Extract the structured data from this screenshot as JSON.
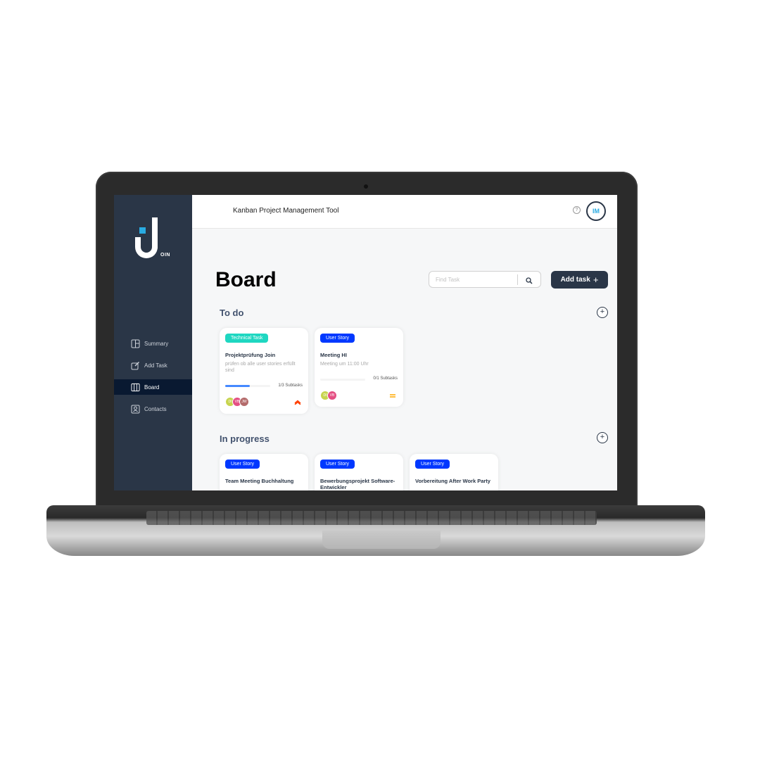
{
  "app": {
    "header_title": "Kanban Project Management Tool",
    "help_symbol": "?",
    "user_initials": "IM",
    "logo_word": "OIN"
  },
  "sidebar": {
    "items": [
      {
        "label": "Summary",
        "icon": "summary-icon",
        "active": false
      },
      {
        "label": "Add Task",
        "icon": "add-task-icon",
        "active": false
      },
      {
        "label": "Board",
        "icon": "board-icon",
        "active": true
      },
      {
        "label": "Contacts",
        "icon": "contacts-icon",
        "active": false
      }
    ]
  },
  "board": {
    "title": "Board",
    "search_placeholder": "Find Task",
    "add_task_label": "Add task",
    "add_task_symbol": "+"
  },
  "columns": {
    "todo": {
      "title": "To do",
      "cards": [
        {
          "tag": "Technical Task",
          "title": "Projektprüfung Join",
          "desc": "prüfen ob alle user stories erfüllt sind",
          "subtasks": "1/3 Subtasks",
          "progress": 0.54,
          "avatars": [
            {
              "initials": "DI",
              "color": "#c7d44f"
            },
            {
              "initials": "VB",
              "color": "#e44f83"
            },
            {
              "initials": "JW",
              "color": "#b46b6b"
            }
          ],
          "priority": "high"
        },
        {
          "tag": "User Story",
          "title": "Meeting HI",
          "desc": "Meeting um 11:00 Uhr",
          "subtasks": "0/1 Subtasks",
          "progress": 0.0,
          "avatars": [
            {
              "initials": "DI",
              "color": "#c7d44f"
            },
            {
              "initials": "VB",
              "color": "#e44f83"
            }
          ],
          "priority": "medium"
        }
      ]
    },
    "in_progress": {
      "title": "In progress",
      "cards": [
        {
          "tag": "User Story",
          "title": "Team Meeting Buchhaltung"
        },
        {
          "tag": "User Story",
          "title": "Bewerbungsprojekt Software-Entwickler"
        },
        {
          "tag": "User Story",
          "title": "Vorbereitung After Work Party"
        }
      ]
    },
    "add_symbol": "+"
  },
  "colors": {
    "sidebar": "#2a3647",
    "sidebar_active": "#091931",
    "accent": "#29abe2",
    "tag_technical": "#1fd7c1",
    "tag_story": "#0038ff",
    "priority_high": "#ff3d00",
    "priority_medium": "#ffa800"
  }
}
